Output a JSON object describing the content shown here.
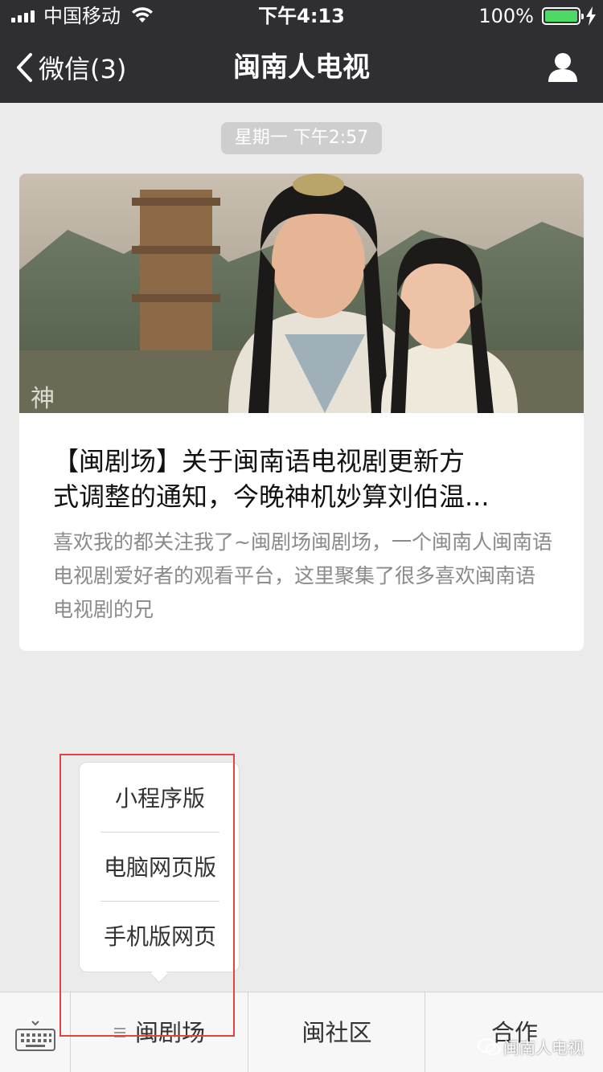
{
  "status_bar": {
    "carrier": "中国移动",
    "time": "下午4:13",
    "battery": "100%"
  },
  "nav": {
    "back_label": "微信(3)",
    "title": "闽南人电视"
  },
  "chat": {
    "timestamp": "星期一 下午2:57",
    "article": {
      "title_line1": "【闽剧场】关于闽南语电视剧更新方",
      "title_line2": "式调整的通知，今晚神机妙算刘伯温...",
      "description": "喜欢我的都关注我了~闽剧场闽剧场，一个闽南人闽南语电视剧爱好者的观看平台，这里聚集了很多喜欢闽南语电视剧的兄"
    }
  },
  "popup_menu": {
    "items": [
      "小程序版",
      "电脑网页版",
      "手机版网页"
    ]
  },
  "bottom_menu": {
    "tabs": [
      "闽剧场",
      "闽社区",
      "合作"
    ]
  },
  "watermark": "闽南人电视",
  "colors": {
    "bar_background": "#2e2e33",
    "chat_background": "#ebebeb",
    "highlight_border": "#e0443e",
    "battery_green": "#4cd964"
  }
}
